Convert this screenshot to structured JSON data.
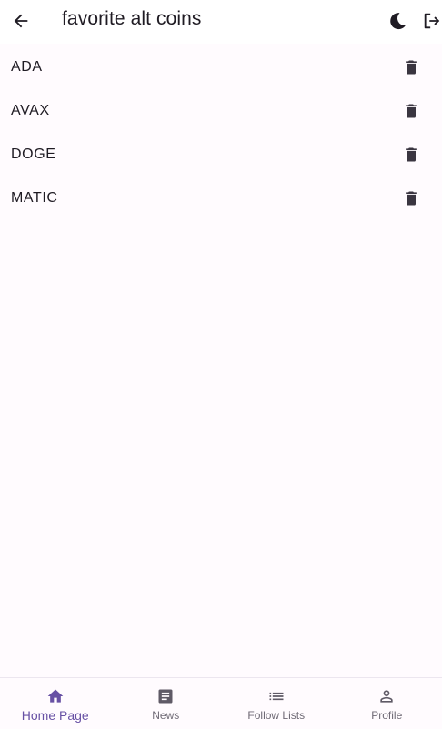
{
  "header": {
    "title": "favorite alt coins",
    "back_icon": "arrow-back-icon",
    "theme_icon": "moon-icon",
    "logout_icon": "logout-icon"
  },
  "list": {
    "items": [
      {
        "label": "ADA"
      },
      {
        "label": "AVAX"
      },
      {
        "label": "DOGE"
      },
      {
        "label": "MATIC"
      }
    ],
    "delete_icon": "trash-icon"
  },
  "bottom_nav": {
    "active_color": "#6750a4",
    "inactive_color": "#6f6a75",
    "items": [
      {
        "label": "Home Page",
        "icon": "home-icon",
        "active": true
      },
      {
        "label": "News",
        "icon": "article-icon",
        "active": false
      },
      {
        "label": "Follow Lists",
        "icon": "list-icon",
        "active": false
      },
      {
        "label": "Profile",
        "icon": "person-icon",
        "active": false
      }
    ]
  }
}
